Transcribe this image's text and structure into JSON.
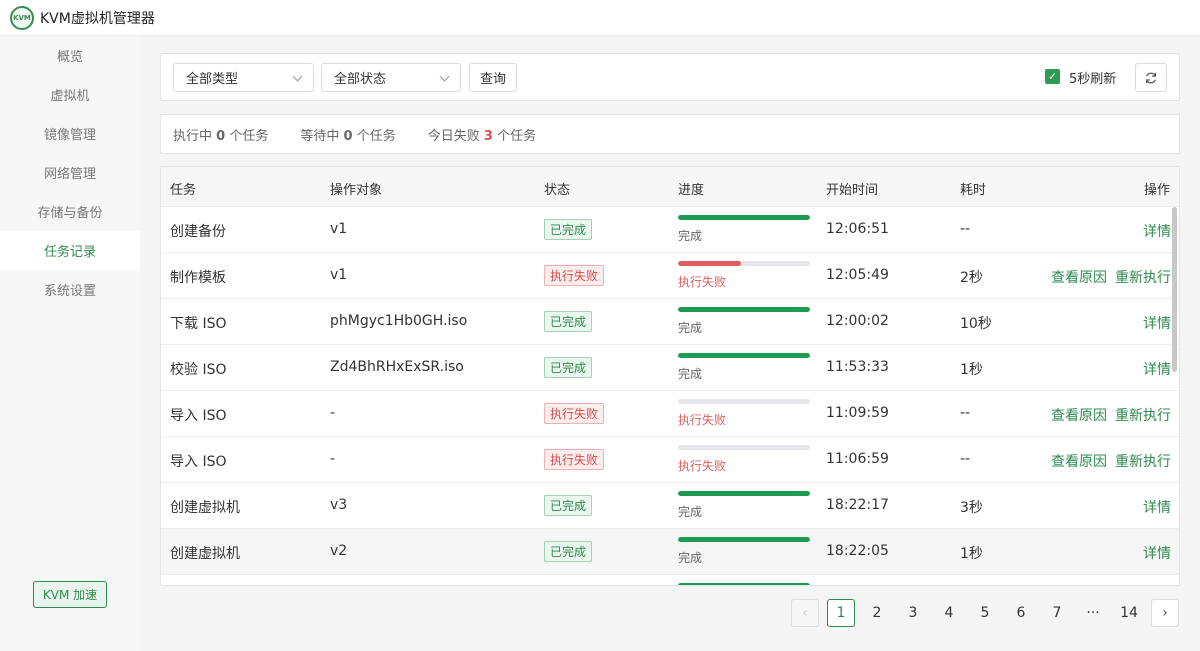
{
  "app": {
    "title": "KVM虚拟机管理器",
    "logo_text": "KVM"
  },
  "sidebar": {
    "items": [
      {
        "label": "概览"
      },
      {
        "label": "虚拟机"
      },
      {
        "label": "镜像管理"
      },
      {
        "label": "网络管理"
      },
      {
        "label": "存储与备份"
      },
      {
        "label": "任务记录",
        "active": true
      },
      {
        "label": "系统设置"
      }
    ],
    "accel_button": "KVM 加速"
  },
  "filters": {
    "type_select": "全部类型",
    "status_select": "全部状态",
    "query_button": "查询",
    "auto_refresh_checked": true,
    "auto_refresh_label": "5秒刷新",
    "refresh_icon": "refresh-icon"
  },
  "stats": {
    "running_prefix": "执行中",
    "running_count": "0",
    "running_suffix": "个任务",
    "waiting_prefix": "等待中",
    "waiting_count": "0",
    "waiting_suffix": "个任务",
    "failed_prefix": "今日失败",
    "failed_count": "3",
    "failed_suffix": "个任务"
  },
  "table": {
    "headers": {
      "task": "任务",
      "target": "操作对象",
      "status": "状态",
      "progress": "进度",
      "start_time": "开始时间",
      "duration": "耗时",
      "actions": "操作"
    },
    "rows": [
      {
        "task": "创建备份",
        "target": "v1",
        "status": "已完成",
        "status_type": "done",
        "progress": 1.0,
        "progress_label": "完成",
        "start": "12:06:51",
        "duration": "--",
        "actions": [
          "详情"
        ]
      },
      {
        "task": "制作模板",
        "target": "v1",
        "status": "执行失败",
        "status_type": "fail",
        "progress": 0.48,
        "progress_label": "执行失败",
        "start": "12:05:49",
        "duration": "2秒",
        "actions": [
          "查看原因",
          "重新执行"
        ]
      },
      {
        "task": "下载 ISO",
        "target": "phMgyc1Hb0GH.iso",
        "status": "已完成",
        "status_type": "done",
        "progress": 1.0,
        "progress_label": "完成",
        "start": "12:00:02",
        "duration": "10秒",
        "actions": [
          "详情"
        ]
      },
      {
        "task": "校验 ISO",
        "target": "Zd4BhRHxExSR.iso",
        "status": "已完成",
        "status_type": "done",
        "progress": 1.0,
        "progress_label": "完成",
        "start": "11:53:33",
        "duration": "1秒",
        "actions": [
          "详情"
        ]
      },
      {
        "task": "导入 ISO",
        "target": "-",
        "status": "执行失败",
        "status_type": "fail",
        "progress": 0,
        "progress_label": "执行失败",
        "start": "11:09:59",
        "duration": "--",
        "actions": [
          "查看原因",
          "重新执行"
        ]
      },
      {
        "task": "导入 ISO",
        "target": "-",
        "status": "执行失败",
        "status_type": "fail",
        "progress": 0,
        "progress_label": "执行失败",
        "start": "11:06:59",
        "duration": "--",
        "actions": [
          "查看原因",
          "重新执行"
        ]
      },
      {
        "task": "创建虚拟机",
        "target": "v3",
        "status": "已完成",
        "status_type": "done",
        "progress": 1.0,
        "progress_label": "完成",
        "start": "18:22:17",
        "duration": "3秒",
        "actions": [
          "详情"
        ]
      },
      {
        "task": "创建虚拟机",
        "target": "v2",
        "status": "已完成",
        "status_type": "done",
        "progress": 1.0,
        "progress_label": "完成",
        "start": "18:22:05",
        "duration": "1秒",
        "actions": [
          "详情"
        ],
        "hover": true
      },
      {
        "task": "",
        "target": "",
        "status": "",
        "status_type": "done",
        "progress": 1.0,
        "progress_label": "",
        "start": "",
        "duration": "",
        "actions": []
      }
    ]
  },
  "pagination": {
    "pages": [
      "1",
      "2",
      "3",
      "4",
      "5",
      "6",
      "7",
      "···",
      "14"
    ],
    "current": "1",
    "prev_icon": "chevron-left-icon",
    "next_icon": "chevron-right-icon"
  },
  "colors": {
    "accent": "#2e8b4f",
    "fail": "#e06060",
    "progress_done": "#1f9a52"
  }
}
